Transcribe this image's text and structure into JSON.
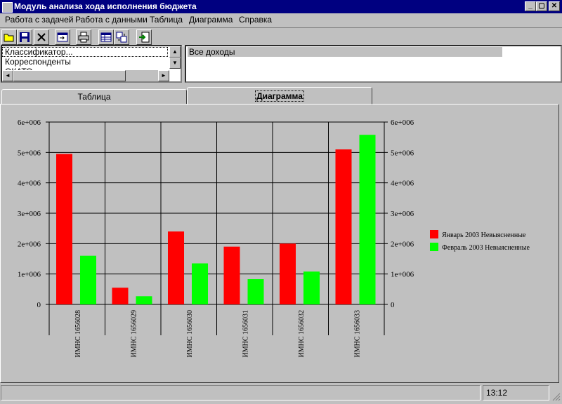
{
  "window": {
    "title": "Модуль анализа хода исполнения бюджета",
    "min": "_",
    "max": "▢",
    "close": "✕"
  },
  "menu": [
    "Работа с задачей",
    "Работа с данными",
    "Таблица",
    "Диаграмма",
    "Справка"
  ],
  "toolbar": [
    "open-icon",
    "save-icon",
    "delete-icon",
    "import-icon",
    "print-icon",
    "table-icon",
    "recalc-icon",
    "export-icon"
  ],
  "left_list": [
    "Классификатор...",
    "Корреспонденты",
    "ОКАТО"
  ],
  "right_list": [
    "Все доходы"
  ],
  "tabs": [
    {
      "label": "Таблица",
      "active": false
    },
    {
      "label": "Диаграмма",
      "active": true
    }
  ],
  "status": {
    "text": "",
    "time": "13:12"
  },
  "chart_data": {
    "type": "bar",
    "categories": [
      "ИМНС 1656028",
      "ИМНС 1656029",
      "ИМНС 1656030",
      "ИМНС 1656031",
      "ИМНС 1656032",
      "ИМНС 1656033"
    ],
    "series": [
      {
        "name": "Январь 2003 Невыясненные",
        "color": "#ff0000",
        "values": [
          4950000,
          550000,
          2400000,
          1900000,
          2000000,
          5100000
        ]
      },
      {
        "name": "Февраль 2003 Невыясненные",
        "color": "#00ff00",
        "values": [
          1600000,
          270000,
          1350000,
          830000,
          1080000,
          5580000
        ]
      }
    ],
    "y_ticks": [
      "0",
      "1e+006",
      "2e+006",
      "3e+006",
      "4e+006",
      "5e+006",
      "6e+006"
    ],
    "ylim": [
      0,
      6000000
    ],
    "grid": true,
    "legend": "right"
  }
}
